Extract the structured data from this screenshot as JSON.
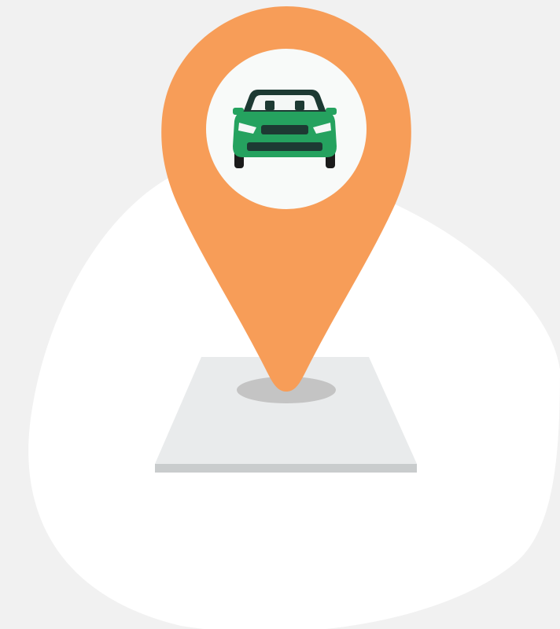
{
  "illustration": {
    "subject": "location-pin-with-car",
    "icons": [
      "map-pin-icon",
      "car-icon"
    ],
    "colors": {
      "background": "#f1f1f1",
      "blob": "#ffffff",
      "pin": "#f79d58",
      "pin_inner_circle": "#f8faf9",
      "car_body": "#25a25f",
      "car_dark": "#1d3a33",
      "car_window": "#f4f7f6",
      "car_wheels": "#1b1b1b",
      "platform_top": "#e9ebec",
      "platform_edge": "#c9cccd",
      "pin_shadow": "#c4c4c4"
    }
  }
}
